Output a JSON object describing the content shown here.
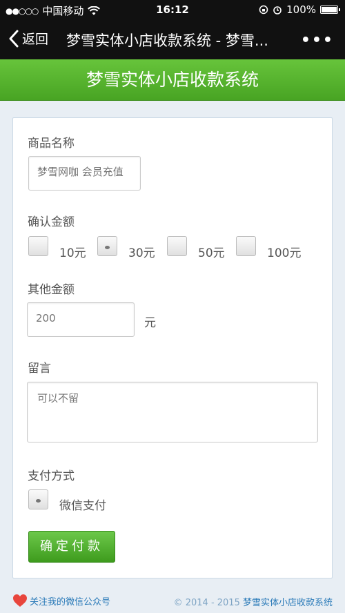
{
  "status_bar": {
    "carrier": "中国移动",
    "time": "16:12",
    "battery": "100%"
  },
  "nav": {
    "back_label": "返回",
    "title": "梦雪实体小店收款系统 - 梦雪...",
    "more_label": "•••"
  },
  "header": {
    "title": "梦雪实体小店收款系统"
  },
  "form": {
    "product_label": "商品名称",
    "product_placeholder": "梦雪网咖 会员充值",
    "amount_label": "确认金额",
    "amount_options": [
      "10元",
      "30元",
      "50元",
      "100元"
    ],
    "other_amount_label": "其他金额",
    "other_amount_placeholder": "200",
    "other_amount_unit": "元",
    "message_label": "留言",
    "message_placeholder": "可以不留",
    "payment_label": "支付方式",
    "payment_option": "微信支付",
    "submit_label": "确定付款"
  },
  "footer": {
    "follow_label": "关注我的微信公众号",
    "copyright": "© 2014 - 2015 ",
    "brand": "梦雪实体小店收款系统"
  }
}
